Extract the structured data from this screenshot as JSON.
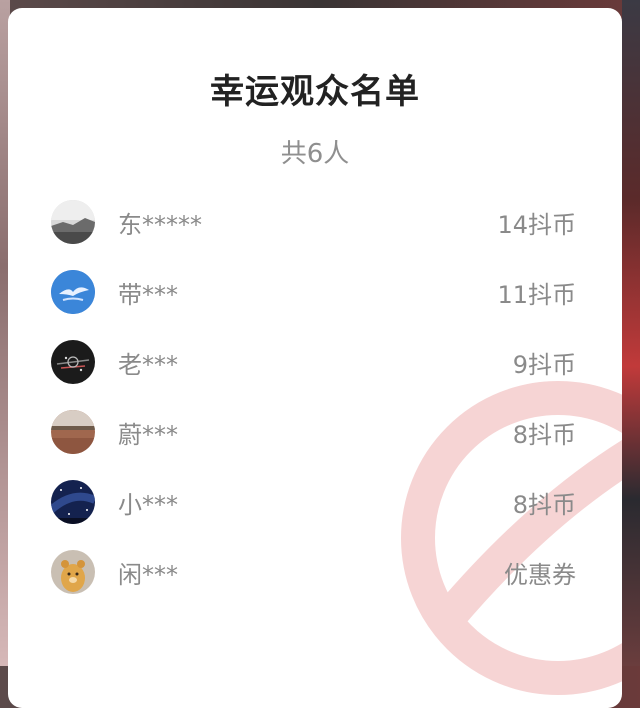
{
  "dialog": {
    "title": "幸运观众名单",
    "count_text": "共6人"
  },
  "winners": [
    {
      "name": "东*****",
      "reward": "14抖币",
      "avatar": "gray-landscape-avatar"
    },
    {
      "name": "带***",
      "reward": "11抖币",
      "avatar": "blue-sky-bird-avatar"
    },
    {
      "name": "老***",
      "reward": "9抖币",
      "avatar": "dark-cityscape-avatar"
    },
    {
      "name": "蔚***",
      "reward": "8抖币",
      "avatar": "brown-field-avatar"
    },
    {
      "name": "小***",
      "reward": "8抖币",
      "avatar": "starry-night-avatar"
    },
    {
      "name": "闲***",
      "reward": "优惠券",
      "avatar": "cartoon-bear-avatar"
    }
  ],
  "colors": {
    "title": "#222222",
    "secondary_text": "#8a8a8a",
    "watermark": "#f3c9c9"
  }
}
